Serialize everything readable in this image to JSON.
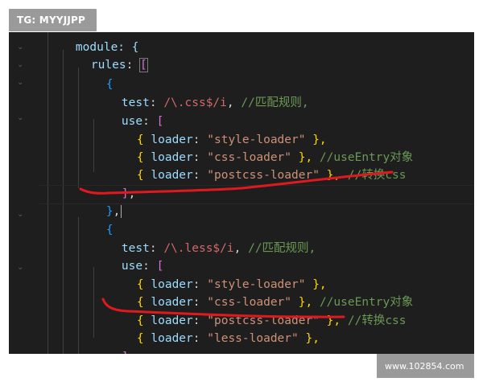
{
  "top_tag": "TG: MYYJJPP",
  "watermark": "www.102854.com",
  "colors": {
    "editor_bg": "#1e1e1e",
    "brace": "#ffd700",
    "bracket_purple": "#da70d6",
    "property": "#9cdcfe",
    "string": "#ce9178",
    "regex": "#d16969",
    "comment": "#6a9955",
    "red_mark": "#e0191f"
  },
  "code": {
    "l0": {
      "a": "module: {"
    },
    "l1": {
      "prop": "rules",
      "colon": ": ",
      "bracket": "["
    },
    "l2": {
      "brace": "{"
    },
    "l3": {
      "prop": "test",
      "colon": ": ",
      "regex": "/\\.css$/i",
      "comma": ", ",
      "comment": "//匹配规则,"
    },
    "l4": {
      "prop": "use",
      "colon": ": ",
      "bracket": "["
    },
    "l5": {
      "open": "{ ",
      "prop": "loader",
      "colon": ": ",
      "str": "\"style-loader\"",
      "close": " },"
    },
    "l6": {
      "open": "{ ",
      "prop": "loader",
      "colon": ": ",
      "str": "\"css-loader\"",
      "close": " }, ",
      "comment": "//useEntry对象"
    },
    "l7": {
      "open": "{ ",
      "prop": "loader",
      "colon": ": ",
      "str": "\"postcss-loader\"",
      "close": " }, ",
      "comment": "//转换css"
    },
    "l8": {
      "bracket": "]",
      "comma": ","
    },
    "l9": {
      "brace": "}",
      "comma": ","
    },
    "l10": {
      "brace": "{"
    },
    "l11": {
      "prop": "test",
      "colon": ": ",
      "regex": "/\\.less$/i",
      "comma": ", ",
      "comment": "//匹配规则,"
    },
    "l12": {
      "prop": "use",
      "colon": ": ",
      "bracket": "["
    },
    "l13": {
      "open": "{ ",
      "prop": "loader",
      "colon": ": ",
      "str": "\"style-loader\"",
      "close": " },"
    },
    "l14": {
      "open": "{ ",
      "prop": "loader",
      "colon": ": ",
      "str": "\"css-loader\"",
      "close": " }, ",
      "comment": "//useEntry对象"
    },
    "l15": {
      "open": "{ ",
      "prop": "loader",
      "colon": ": ",
      "str": "\"postcss-loader\"",
      "close": " }, ",
      "comment": "//转换css"
    },
    "l16": {
      "open": "{ ",
      "prop": "loader",
      "colon": ": ",
      "str": "\"less-loader\"",
      "close": " },"
    },
    "l17": {
      "bracket": "]",
      "comma": ","
    }
  }
}
